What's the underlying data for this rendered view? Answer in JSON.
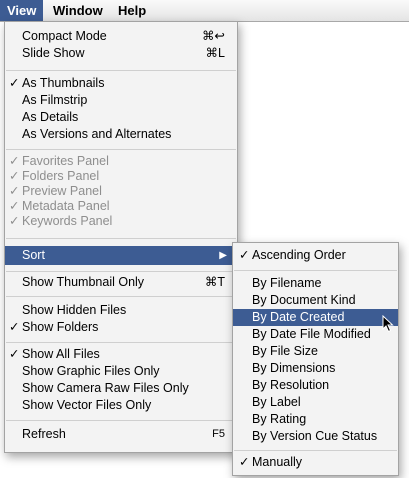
{
  "menubar": {
    "view": "View",
    "window": "Window",
    "help": "Help"
  },
  "view_menu": {
    "compact_mode": {
      "label": "Compact Mode",
      "shortcut": "⌘↩"
    },
    "slide_show": {
      "label": "Slide Show",
      "shortcut": "⌘L"
    },
    "as_thumbnails": {
      "label": "As Thumbnails",
      "check": "✓"
    },
    "as_filmstrip": {
      "label": "As Filmstrip"
    },
    "as_details": {
      "label": "As Details"
    },
    "as_versions": {
      "label": "As Versions and Alternates"
    },
    "favorites_panel": {
      "label": "Favorites Panel",
      "check": "✓"
    },
    "folders_panel": {
      "label": "Folders Panel",
      "check": "✓"
    },
    "preview_panel": {
      "label": "Preview Panel",
      "check": "✓"
    },
    "metadata_panel": {
      "label": "Metadata Panel",
      "check": "✓"
    },
    "keywords_panel": {
      "label": "Keywords Panel",
      "check": "✓"
    },
    "sort": {
      "label": "Sort",
      "arrow": "▶"
    },
    "show_thumbnail_only": {
      "label": "Show Thumbnail Only",
      "shortcut": "⌘T"
    },
    "show_hidden_files": {
      "label": "Show Hidden Files"
    },
    "show_folders": {
      "label": "Show Folders",
      "check": "✓"
    },
    "show_all_files": {
      "label": "Show All Files",
      "check": "✓"
    },
    "show_graphic_files": {
      "label": "Show Graphic Files Only"
    },
    "show_camera_raw": {
      "label": "Show Camera Raw Files Only"
    },
    "show_vector": {
      "label": "Show Vector Files Only"
    },
    "refresh": {
      "label": "Refresh",
      "shortcut": "F5"
    }
  },
  "sort_menu": {
    "ascending": {
      "label": "Ascending Order",
      "check": "✓"
    },
    "by_filename": {
      "label": "By Filename"
    },
    "by_document_kind": {
      "label": "By Document Kind"
    },
    "by_date_created": {
      "label": "By Date Created"
    },
    "by_date_modified": {
      "label": "By Date File Modified"
    },
    "by_file_size": {
      "label": "By File Size"
    },
    "by_dimensions": {
      "label": "By Dimensions"
    },
    "by_resolution": {
      "label": "By Resolution"
    },
    "by_label": {
      "label": "By Label"
    },
    "by_rating": {
      "label": "By Rating"
    },
    "by_version_cue": {
      "label": "By Version Cue Status"
    },
    "manually": {
      "label": "Manually",
      "check": "✓"
    }
  },
  "colors": {
    "highlight": "#3d5c93",
    "menu_bg": "#f3f3f3",
    "disabled_text": "#8e8e8e"
  }
}
